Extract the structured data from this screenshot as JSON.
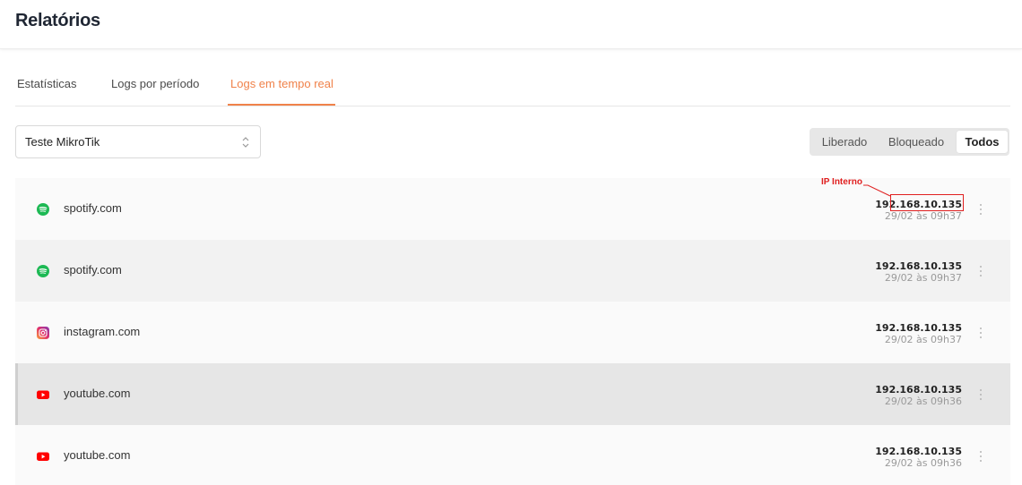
{
  "header": {
    "title": "Relatórios"
  },
  "tabs": [
    {
      "label": "Estatísticas"
    },
    {
      "label": "Logs por período"
    },
    {
      "label": "Logs em tempo real",
      "active": true
    }
  ],
  "device_select": {
    "value": "Teste MikroTik"
  },
  "filter": {
    "options": [
      "Liberado",
      "Bloqueado",
      "Todos"
    ],
    "selected": "Todos"
  },
  "annotation": {
    "label": "IP Interno",
    "color": "#e02020"
  },
  "colors": {
    "accent": "#f0824a",
    "spotify": "#1db954",
    "youtube": "#ff0000"
  },
  "logs": [
    {
      "site": "spotify.com",
      "icon": "spotify-icon",
      "ip": "192.168.10.135",
      "time": "29/02 às 09h37"
    },
    {
      "site": "spotify.com",
      "icon": "spotify-icon",
      "ip": "192.168.10.135",
      "time": "29/02 às 09h37"
    },
    {
      "site": "instagram.com",
      "icon": "instagram-icon",
      "ip": "192.168.10.135",
      "time": "29/02 às 09h37"
    },
    {
      "site": "youtube.com",
      "icon": "youtube-icon",
      "ip": "192.168.10.135",
      "time": "29/02 às 09h36"
    },
    {
      "site": "youtube.com",
      "icon": "youtube-icon",
      "ip": "192.168.10.135",
      "time": "29/02 às 09h36"
    }
  ]
}
